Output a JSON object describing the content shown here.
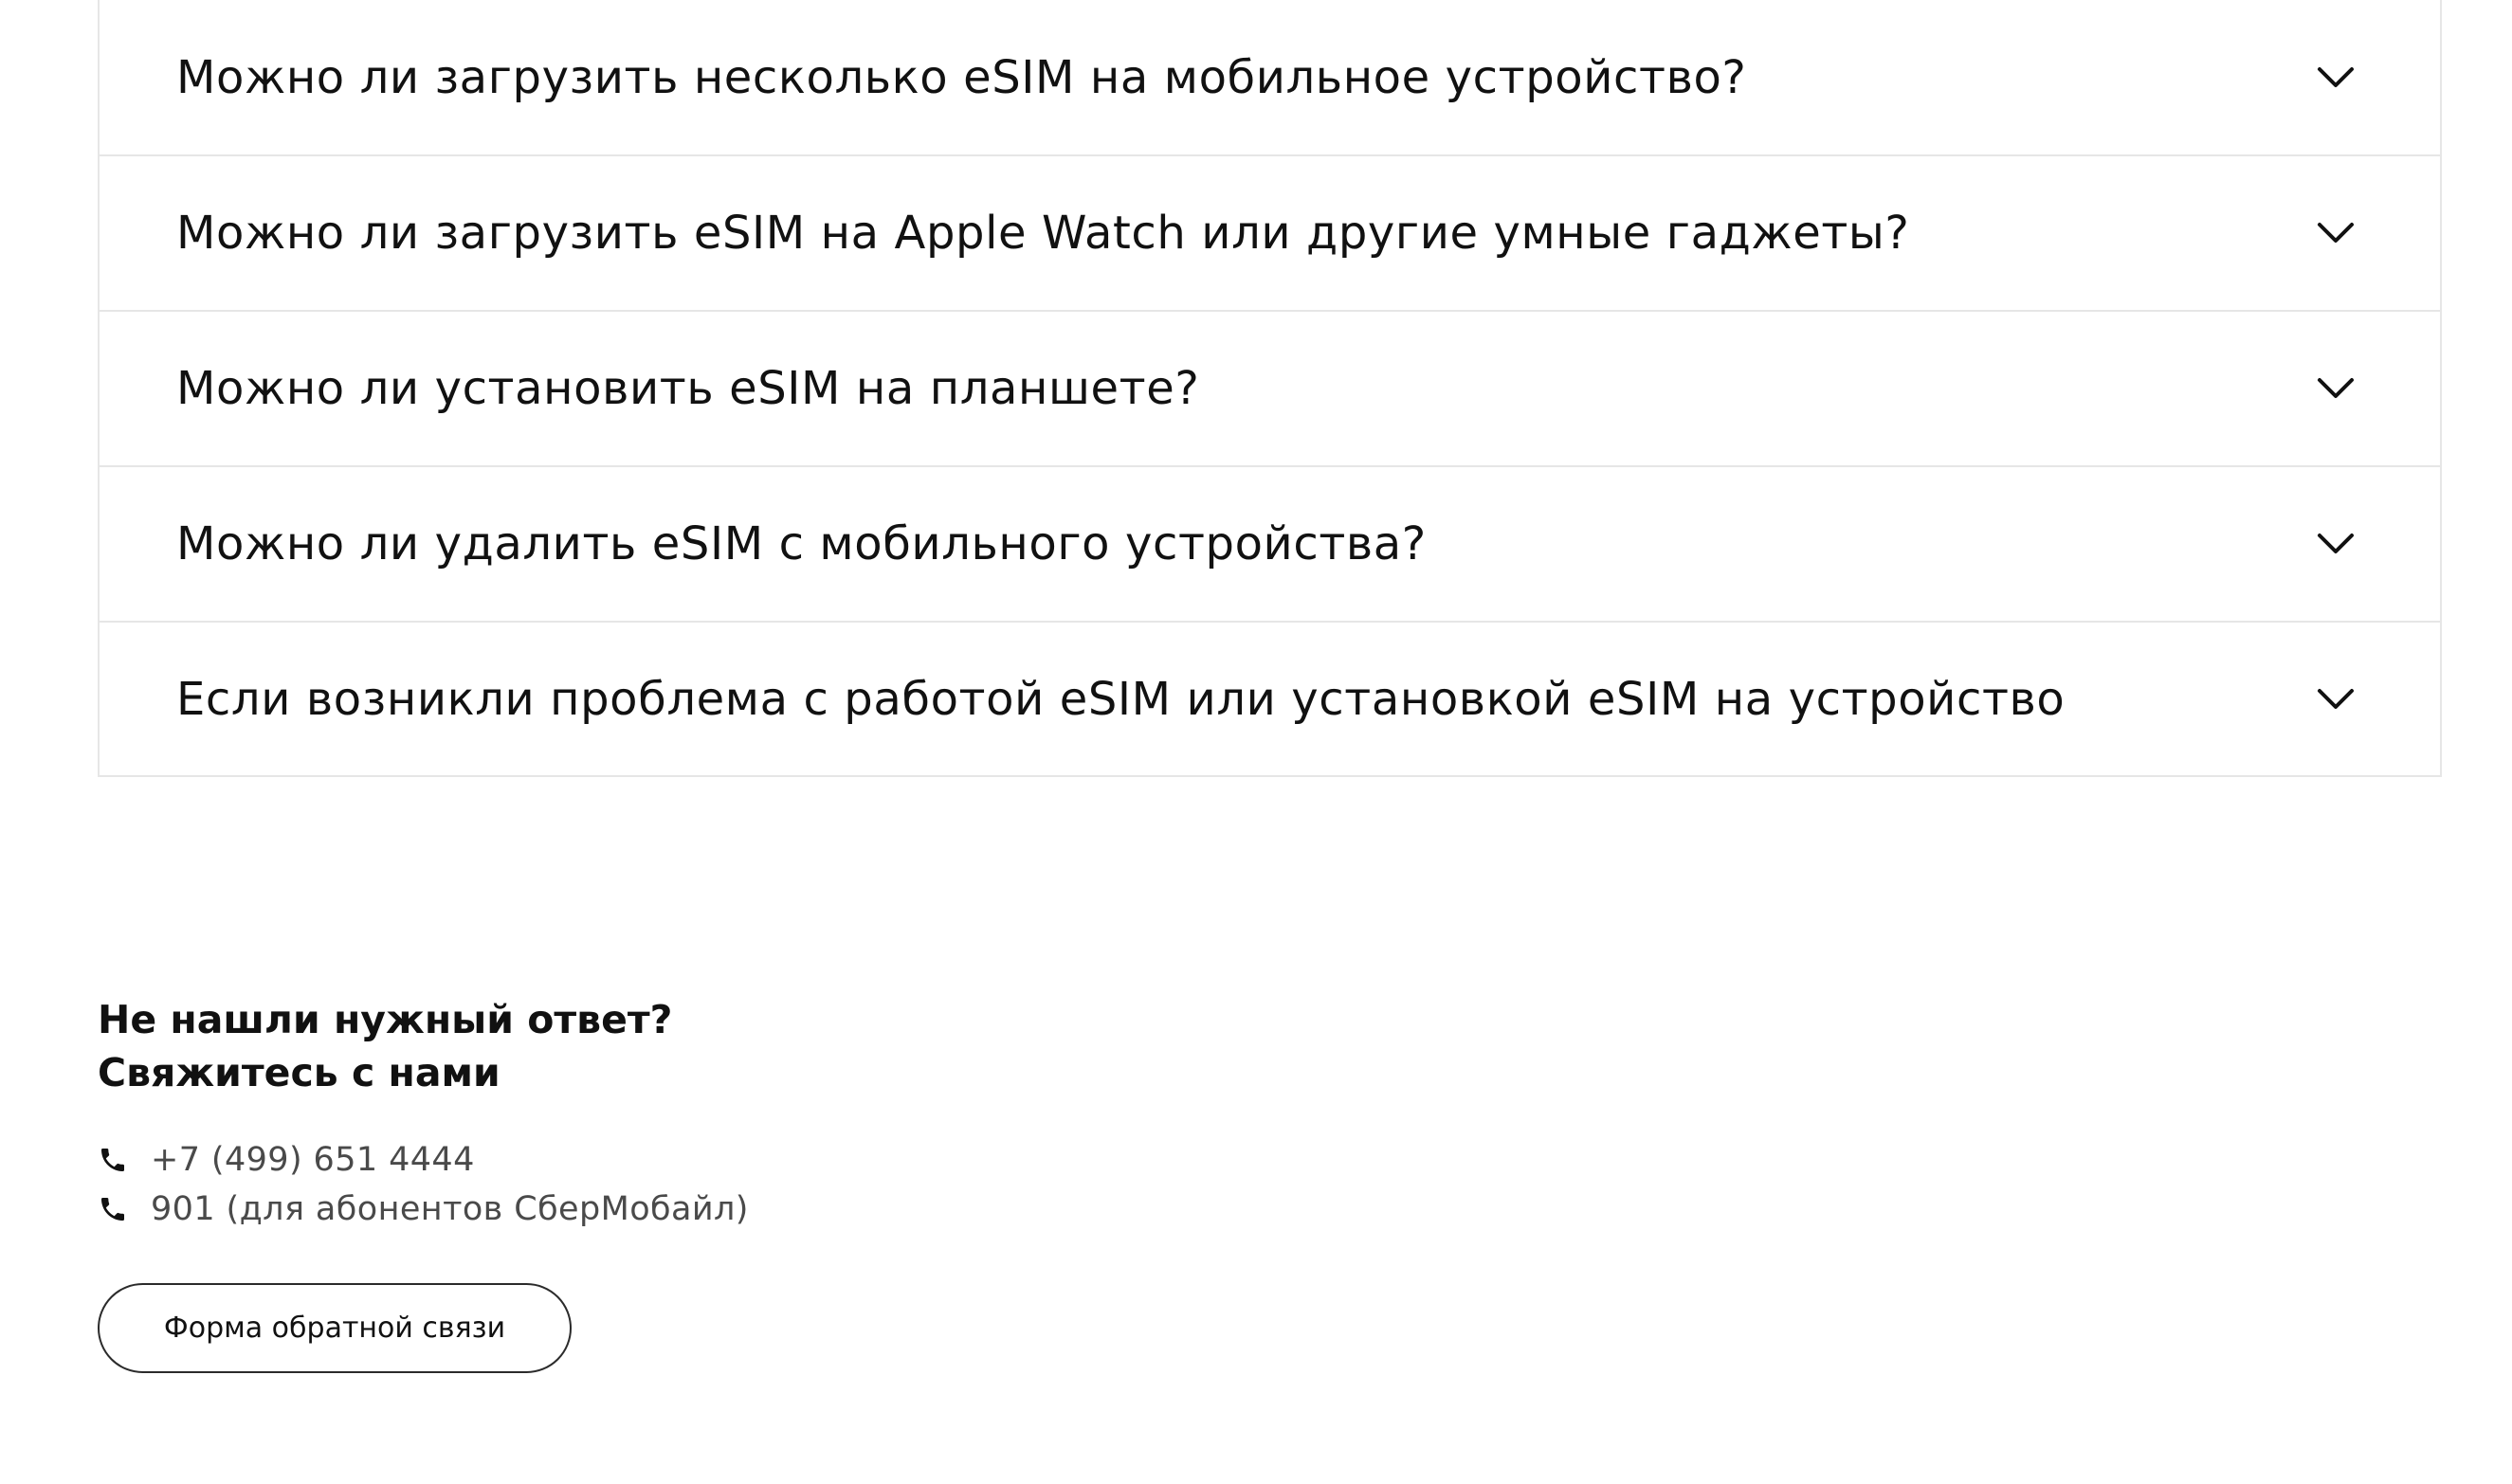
{
  "faq": {
    "items": [
      {
        "question": "Можно ли загрузить несколько eSIM на мобильное устройство?"
      },
      {
        "question": "Можно ли загрузить eSIM на Apple Watch или другие умные гаджеты?"
      },
      {
        "question": "Можно ли установить eSIM на планшете?"
      },
      {
        "question": "Можно ли удалить eSIM с мобильного устройства?"
      },
      {
        "question": "Если возникли проблема с работой eSIM или установкой eSIM на устройство"
      }
    ],
    "chevron_icon": "chevron-down-icon"
  },
  "contact": {
    "title_line1": "Не нашли нужный ответ?",
    "title_line2": "Свяжитесь с нами",
    "phone_icon": "phone-icon",
    "phones": [
      {
        "text": "+7 (499) 651 4444"
      },
      {
        "text": "901 (для абонентов СберМобайл)"
      }
    ],
    "feedback_button_label": "Форма обратной связи"
  }
}
